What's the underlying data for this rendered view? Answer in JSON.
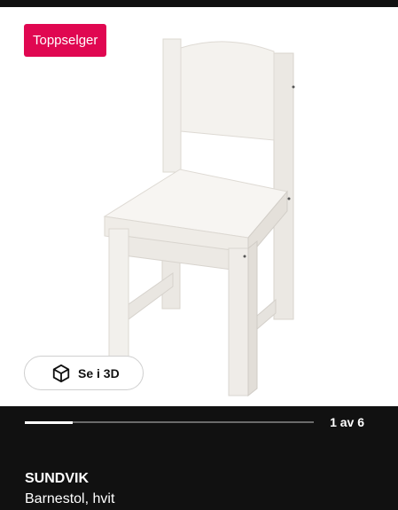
{
  "badge": {
    "label": "Toppselger",
    "color": "#e00751"
  },
  "view3d": {
    "label": "Se i 3D",
    "icon": "cube-icon"
  },
  "carousel": {
    "current": 1,
    "total": 6,
    "counter_text": "1 av 6",
    "progress_fraction": 0.1667
  },
  "product": {
    "name": "SUNDVIK",
    "description": "Barnestol, hvit"
  },
  "colors": {
    "background": "#111111",
    "image_bg": "#ffffff",
    "text": "#ffffff"
  }
}
